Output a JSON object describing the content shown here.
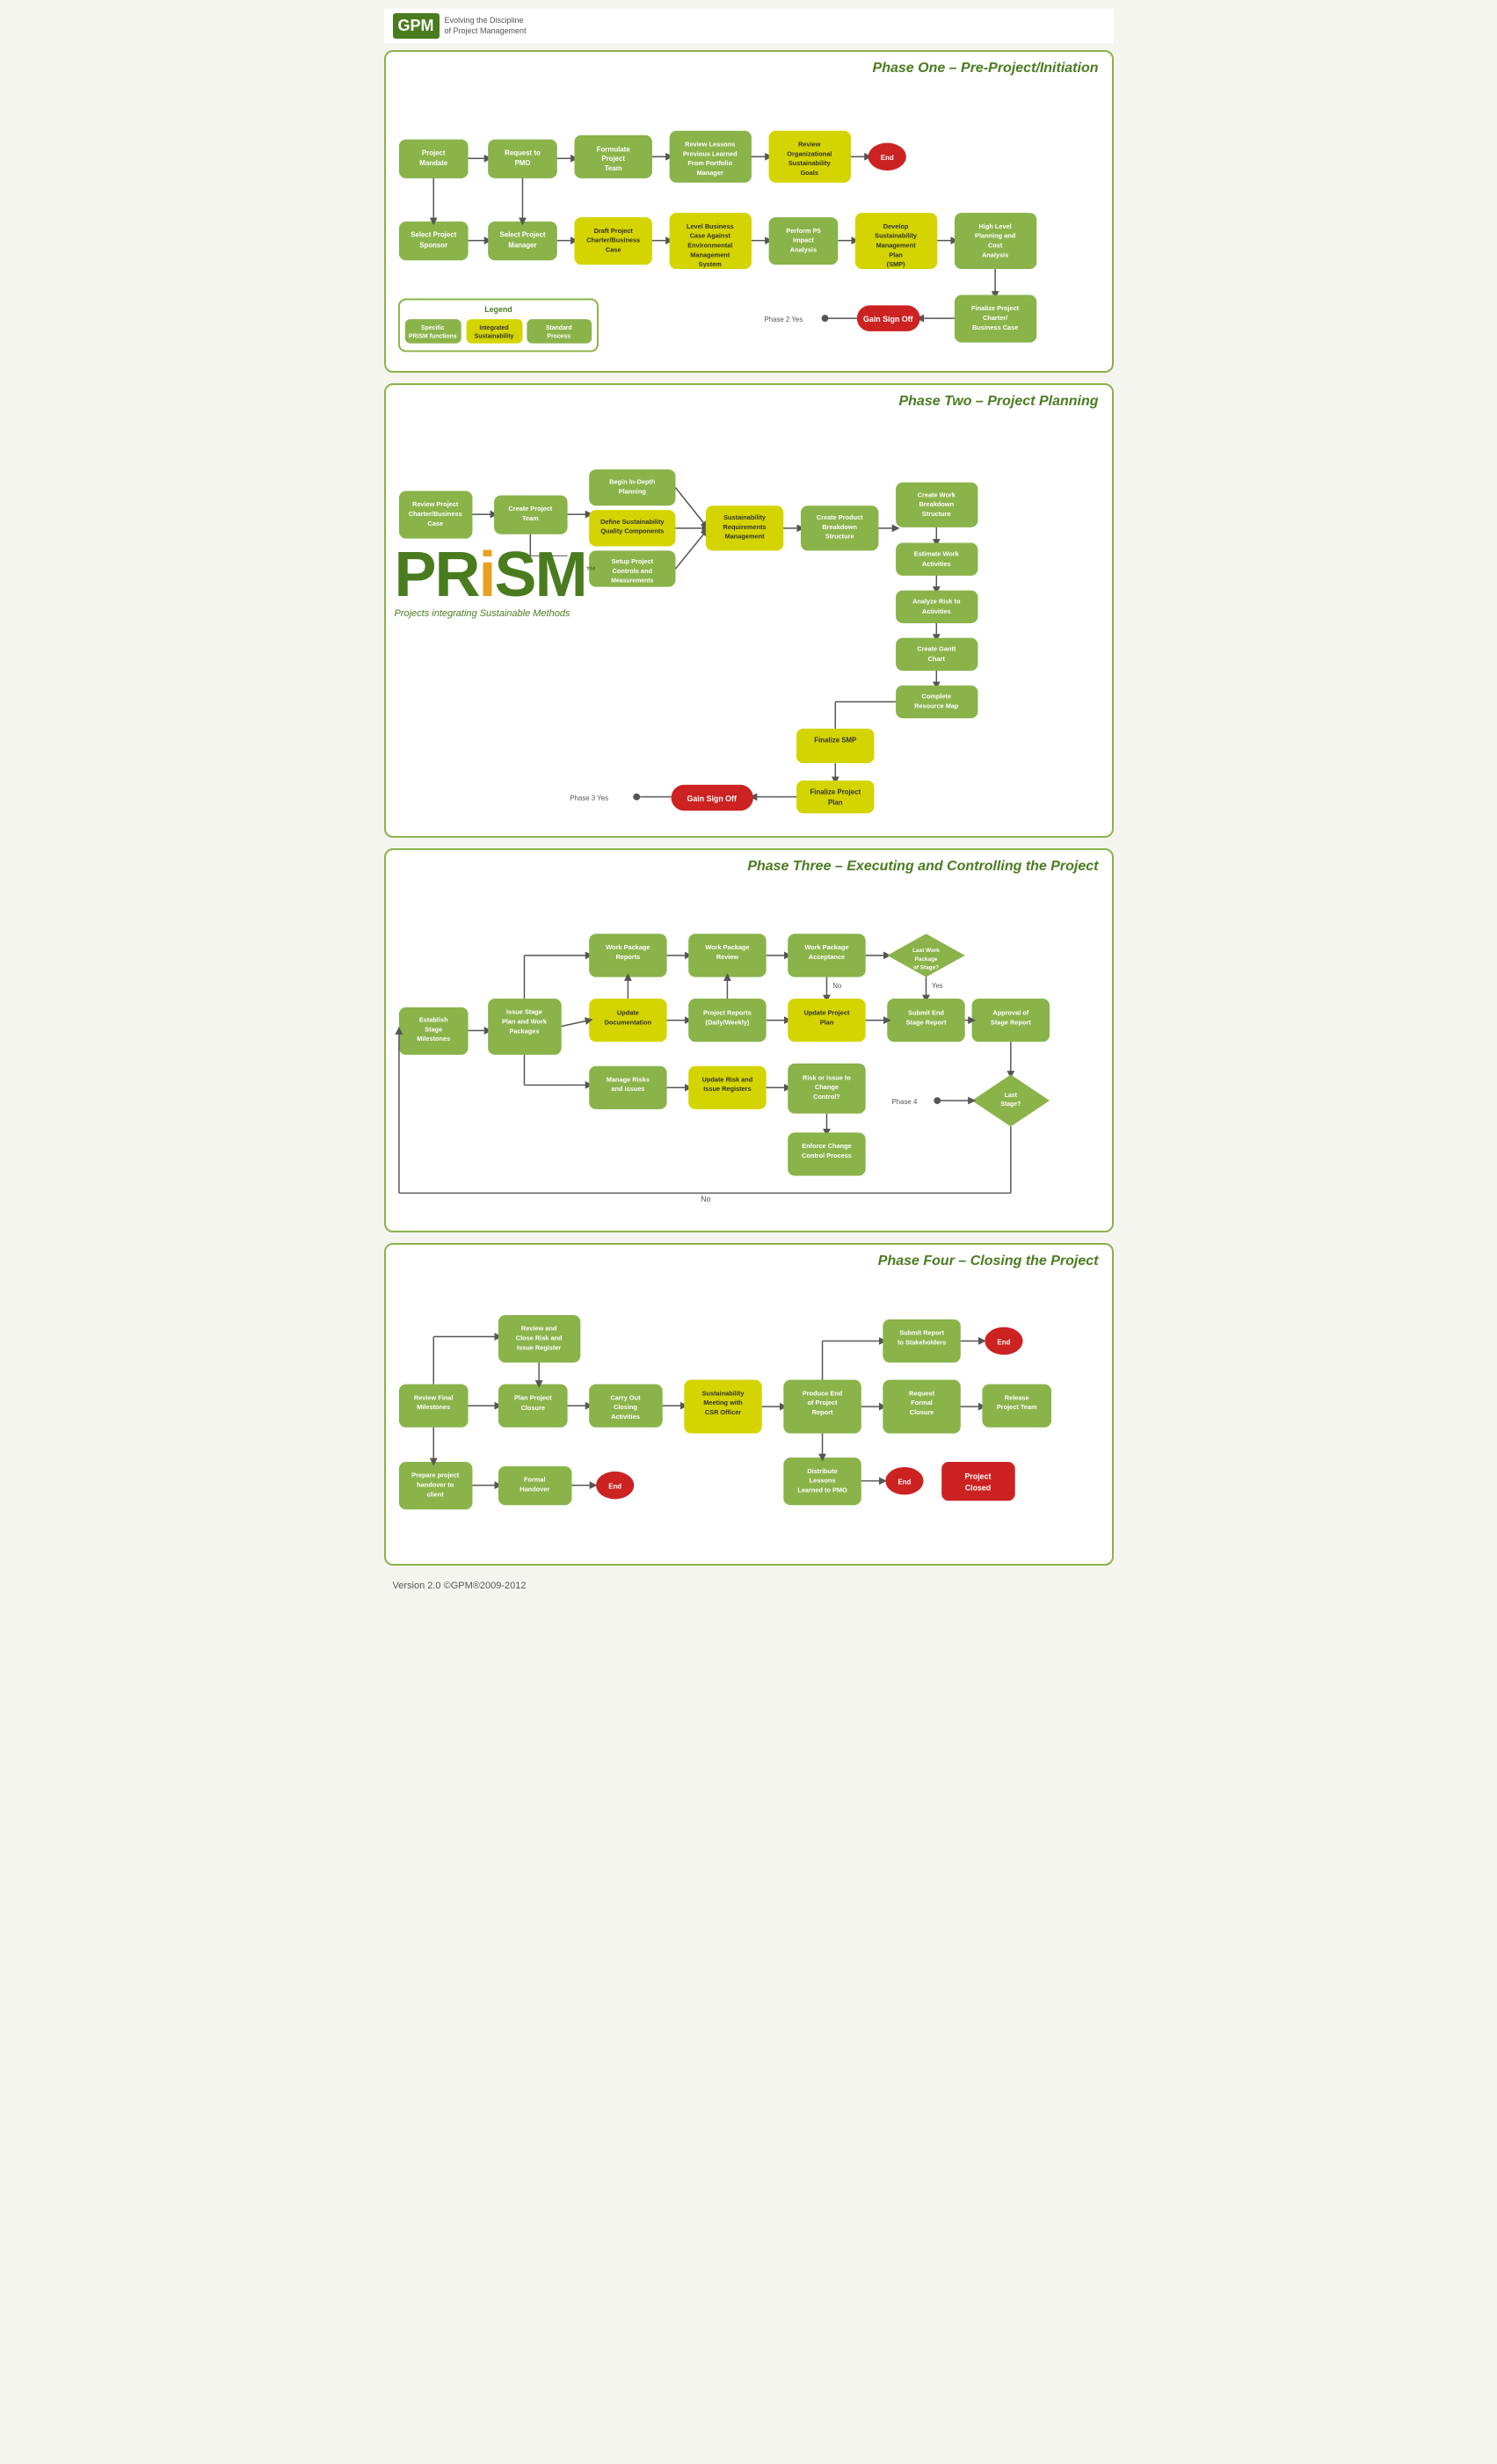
{
  "header": {
    "logo": "GPM",
    "tagline_line1": "Evolving the Discipline",
    "tagline_line2": "of Project Management"
  },
  "phases": [
    {
      "id": "phase1",
      "title": "Phase One – Pre-Project/Initiation",
      "nodes": {
        "project_mandate": "Project Mandate",
        "request_pmo": "Request to PMO",
        "formulate_team": "Formulate Project Team",
        "review_lessons": "Review Lessons Previous Learned From Portfolio Manager",
        "review_org": "Review Organizational Sustainability Goals",
        "end1": "End",
        "select_sponsor": "Select Project Sponsor",
        "select_manager": "Select Project Manager",
        "draft_charter": "Draft Project Charter/ Business Case",
        "level_business": "Level Business Case Against Environmental Management System",
        "perform_p5": "Perform P5 Impact Analysis",
        "develop_smp": "Develop Sustainability Management Plan (SMP)",
        "high_level": "High Level Planning and Cost Analysis",
        "phase2_yes": "Phase 2 Yes",
        "gain_signoff": "Gain Sign Off",
        "finalize_charter": "Finalize Project Charter/ Business Case"
      },
      "legend": {
        "title": "Legend",
        "items": [
          "Specific PRiSM functions",
          "Integrated Sustainability Functions",
          "Standard Process"
        ]
      }
    },
    {
      "id": "phase2",
      "title": "Phase Two – Project Planning",
      "nodes": {
        "review_charter": "Review Project Charter/Business Case",
        "create_team": "Create Project Team",
        "begin_planning": "Begin In-Depth Planning",
        "define_sustainability": "Define Sustainability Quality Components",
        "setup_controls": "Setup Project Controls and Measurements",
        "sustainability_req": "Sustainability Requirements Management",
        "create_product_bs": "Create Product Breakdown Structure",
        "create_wbs": "Create Work Breakdown Structure",
        "estimate_work": "Estimate Work Activities",
        "analyze_risk": "Analyze Risk to Activities",
        "create_gantt": "Create Gantt Chart",
        "complete_resource": "Complete Resource Map",
        "finalize_smp": "Finalize SMP",
        "finalize_plan": "Finalize Project Plan",
        "phase3_yes": "Phase 3 Yes",
        "gain_signoff": "Gain Sign Off"
      },
      "prism": {
        "letters": "PRiSM",
        "tm": "™",
        "tagline": "Projects integrating Sustainable Methods"
      }
    },
    {
      "id": "phase3",
      "title": "Phase Three – Executing and Controlling the Project",
      "nodes": {
        "establish_milestones": "Establish Stage Milestones",
        "issue_stage_plan": "Issue Stage Plan and Work Packages",
        "work_pkg_reports": "Work Package Reports",
        "work_pkg_review": "Work Package Review",
        "work_pkg_acceptance": "Work Package Acceptance",
        "last_work_pkg": "Last Work Package of Stage?",
        "update_docs": "Update Documentation",
        "project_reports": "Project Reports (Daily/Weekly)",
        "update_project_plan": "Update Project Plan",
        "submit_end_stage": "Submit End Stage Report",
        "approval_stage": "Approval of Stage Report",
        "manage_risks": "Manage Risks and Issues",
        "update_risk": "Update Risk and Issue Registers",
        "risk_change": "Risk or Issue to Change Control?",
        "enforce_change": "Enforce Change Control Process",
        "phase4_yes": "Phase 4 Yes",
        "last_stage": "Last Stage?",
        "no_label": "No"
      }
    },
    {
      "id": "phase4",
      "title": "Phase Four – Closing the Project",
      "nodes": {
        "review_final": "Review Final Milestones",
        "review_close_risk": "Review and Close Risk and Issue Register",
        "plan_closure": "Plan Project Closure",
        "carry_out": "Carry Out Closing Activities",
        "sustainability_meeting": "Sustainability Meeting with CSR Officer",
        "produce_end": "Produce End of Project Report",
        "submit_stakeholders": "Submit Report to Stakeholders",
        "end_top": "End",
        "request_closure": "Request Formal Closure",
        "release_team": "Release Project Team",
        "prepare_handover": "Prepare project handover to client",
        "formal_handover": "Formal Handover",
        "end_mid": "End",
        "distribute_lessons": "Distribute Lessons Learned to PMO",
        "end_lessons": "End",
        "project_closed": "Project Closed"
      }
    }
  ],
  "footer": {
    "version": "Version 2.0  ©GPM®2009-2012"
  },
  "colors": {
    "green_dark": "#4a7c1f",
    "green_node": "#8ab34a",
    "yellow_node": "#d4d400",
    "red_node": "#cc2222",
    "border": "#8ab34a",
    "bg": "#f5f5f0"
  }
}
